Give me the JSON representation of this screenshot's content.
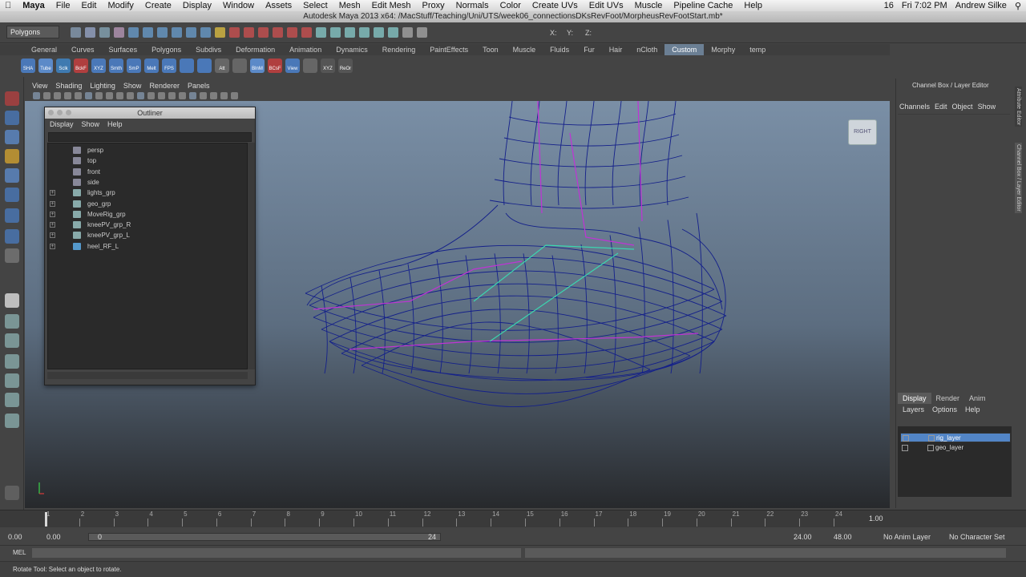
{
  "macbar": {
    "apple": "",
    "app": "Maya",
    "menus": [
      "File",
      "Edit",
      "Modify",
      "Create",
      "Display",
      "Window",
      "Assets",
      "Select",
      "Mesh",
      "Edit Mesh",
      "Proxy",
      "Normals",
      "Color",
      "Create UVs",
      "Edit UVs",
      "Muscle",
      "Pipeline Cache",
      "Help"
    ],
    "battery": "16",
    "clock": "Fri 7:02 PM",
    "user": "Andrew Silke"
  },
  "title": "Autodesk Maya 2013 x64: /MacStuff/Teaching/Uni/UTS/week06_connectionsDKsRevFoot/MorpheusRevFootStart.mb*",
  "statusline": {
    "mode": "Polygons",
    "x_label": "X:",
    "y_label": "Y:",
    "z_label": "Z:"
  },
  "shelf": {
    "tabs": [
      "General",
      "Curves",
      "Surfaces",
      "Polygons",
      "Subdivs",
      "Deformation",
      "Animation",
      "Dynamics",
      "Rendering",
      "PaintEffects",
      "Toon",
      "Muscle",
      "Fluids",
      "Fur",
      "Hair",
      "nCloth",
      "Custom",
      "Morphy",
      "temp"
    ],
    "active_tab": "Custom",
    "icons": [
      "SHA",
      "Tube",
      "Sclk",
      "BckF",
      "XYZ",
      "Smth",
      "SmP",
      "Melt",
      "FPS",
      "",
      "",
      "Att",
      "",
      "BlnM",
      "BCsF",
      "View",
      "",
      "XYZ",
      "ReOr"
    ]
  },
  "viewport": {
    "menus": [
      "View",
      "Shading",
      "Lighting",
      "Show",
      "Renderer",
      "Panels"
    ],
    "viewcube_label": "RIGHT"
  },
  "outliner": {
    "title": "Outliner",
    "menus": [
      "Display",
      "Show",
      "Help"
    ],
    "items": [
      {
        "label": "persp",
        "expandable": false,
        "kind": "camera"
      },
      {
        "label": "top",
        "expandable": false,
        "kind": "camera"
      },
      {
        "label": "front",
        "expandable": false,
        "kind": "camera"
      },
      {
        "label": "side",
        "expandable": false,
        "kind": "camera"
      },
      {
        "label": "lights_grp",
        "expandable": true,
        "kind": "group"
      },
      {
        "label": "geo_grp",
        "expandable": true,
        "kind": "group"
      },
      {
        "label": "MoveRig_grp",
        "expandable": true,
        "kind": "group"
      },
      {
        "label": "kneePV_grp_R",
        "expandable": true,
        "kind": "group"
      },
      {
        "label": "kneePV_grp_L",
        "expandable": true,
        "kind": "group"
      },
      {
        "label": "heel_RF_L",
        "expandable": true,
        "kind": "joint"
      }
    ]
  },
  "channel_box": {
    "title": "Channel Box / Layer Editor",
    "menus": [
      "Channels",
      "Edit",
      "Object",
      "Show"
    ],
    "side_tabs": [
      "Attribute Editor",
      "Channel Box / Layer Editor"
    ],
    "layer_tabs": [
      "Display",
      "Render",
      "Anim"
    ],
    "active_layer_tab": "Display",
    "layer_menus": [
      "Layers",
      "Options",
      "Help"
    ],
    "layers": [
      {
        "name": "rig_layer",
        "selected": true
      },
      {
        "name": "geo_layer",
        "selected": false
      }
    ]
  },
  "timeline": {
    "ticks": [
      "1",
      "2",
      "3",
      "4",
      "5",
      "6",
      "7",
      "8",
      "9",
      "10",
      "11",
      "12",
      "13",
      "14",
      "15",
      "16",
      "17",
      "18",
      "19",
      "20",
      "21",
      "22",
      "23",
      "24"
    ],
    "current_frame": "1.00"
  },
  "range": {
    "start": "0.00",
    "playback_start": "0.00",
    "range_start": "0",
    "range_end": "24",
    "playback_end": "24.00",
    "end": "48.00",
    "anim_layer": "No Anim Layer",
    "character_set": "No Character Set"
  },
  "mel": {
    "label": "MEL"
  },
  "help_line": "Rotate Tool: Select an object to rotate.",
  "colors": {
    "wireframe": "#14208a",
    "joint_pink": "#c033d6",
    "joint_cyan": "#3bd6b0",
    "layer_selected": "#5285c6",
    "shelf_active": "#6b7f94"
  }
}
